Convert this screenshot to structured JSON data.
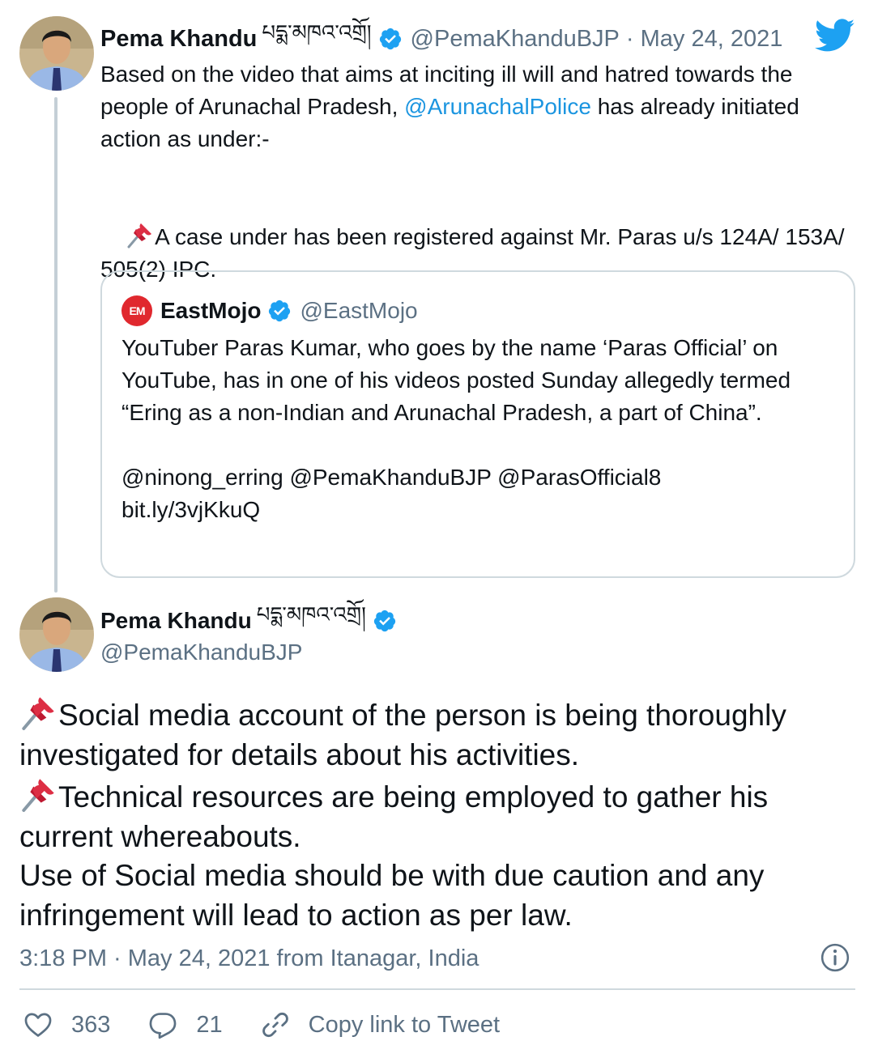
{
  "tweet1": {
    "name": "Pema Khandu",
    "name_tibetan": "པདྨ་མཁའ་འགྲོ།",
    "handle": "@PemaKhanduBJP",
    "date": "· May 24, 2021",
    "text_part1": "Based on the video that aims at inciting ill will and hatred towards the people of Arunachal Pradesh, ",
    "mention": "@ArunachalPolice",
    "text_part2": " has already initiated action as under:-",
    "pin_text": "A case under has been registered against Mr. Paras u/s 124A/ 153A/ 505(2) IPC."
  },
  "quoted": {
    "logo_text": "EM",
    "name": "EastMojo",
    "handle": "@EastMojo",
    "text": "YouTuber Paras Kumar, who goes by the name ‘Paras Official’ on YouTube, has in one of his videos posted Sunday allegedly termed “Ering as a non-Indian and Arunachal Pradesh, a part of China”.",
    "mentions": "@ninong_erring @PemaKhanduBJP @ParasOfficial8",
    "link": "bit.ly/3vjKkuQ"
  },
  "tweet2": {
    "name": "Pema Khandu",
    "name_tibetan": "པདྨ་མཁའ་འགྲོ།",
    "handle": "@PemaKhanduBJP",
    "line1": "Social media account of the person is being thoroughly investigated for details about his activities.",
    "line2": "Technical resources are being employed to gather his current whereabouts.",
    "line3": "Use of Social media should be with due caution and any infringement will lead to action as per law.",
    "meta": "3:18 PM · May 24, 2021 from Itanagar, India"
  },
  "actions": {
    "likes": "363",
    "replies": "21",
    "copy_link": "Copy link to Tweet"
  },
  "colors": {
    "link": "#1b95e0",
    "muted": "#5b7083",
    "verified": "#1da1f2",
    "border": "#cfd9de",
    "pin_red": "#dd2e44"
  },
  "icons": [
    "twitter-bird-icon",
    "verified-badge-icon",
    "pushpin-icon",
    "info-icon",
    "heart-icon",
    "reply-icon",
    "link-icon"
  ]
}
